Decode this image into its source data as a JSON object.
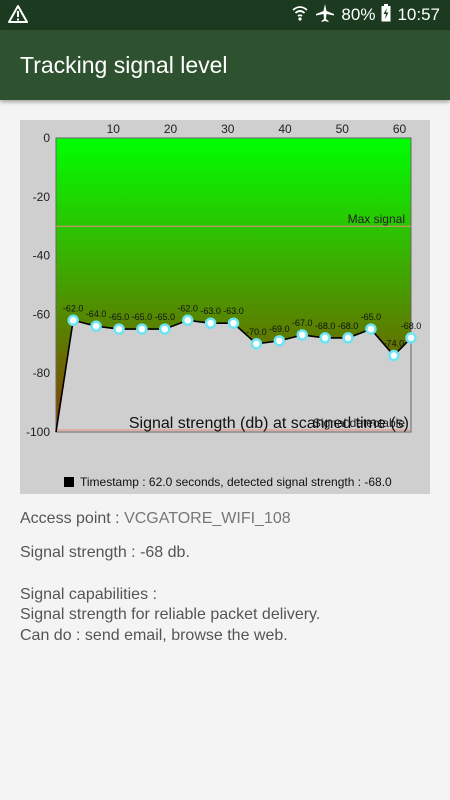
{
  "status_bar": {
    "warning_icon": "warning-icon",
    "battery": "80%",
    "time": "10:57",
    "icons": [
      "wifi-icon",
      "airplane-icon",
      "battery-charging-icon"
    ]
  },
  "app_bar": {
    "title": "Tracking signal level"
  },
  "chart_data": {
    "type": "line",
    "title": "Signal strength (db) at scanned time (s)",
    "xlim": [
      0,
      62
    ],
    "ylim": [
      -100,
      0
    ],
    "x_ticks": [
      "10",
      "20",
      "30",
      "40",
      "50",
      "60"
    ],
    "x_tick_values": [
      10,
      20,
      30,
      40,
      50,
      60
    ],
    "y_ticks": [
      "0",
      "-20",
      "-40",
      "-60",
      "-80",
      "-100"
    ],
    "y_tick_values": [
      0,
      -20,
      -40,
      -60,
      -80,
      -100
    ],
    "reference_lines": [
      {
        "label": "Max signal",
        "y": -30
      },
      {
        "label": "Signal detectable",
        "y": -100
      }
    ],
    "series": [
      {
        "x": [
          0,
          3,
          7,
          11,
          15,
          19,
          23,
          27,
          31,
          35,
          39,
          43,
          47,
          51,
          55,
          59,
          62
        ],
        "y": [
          -100,
          -62,
          -64,
          -65,
          -65,
          -65,
          -62,
          -63,
          -63,
          -70,
          -69,
          -67,
          -68,
          -68,
          -65,
          -74,
          -68
        ],
        "labels": [
          "",
          "-62.0",
          "-64.0",
          "-65.0",
          "-65.0",
          "-65.0",
          "-62.0",
          "-63.0",
          "-63.0",
          "-70.0",
          "-69.0",
          "-67.0",
          "-68.0",
          "-68.0",
          "-65.0",
          "-74.0",
          "-68.0"
        ]
      }
    ],
    "legend": {
      "text": "Timestamp : 62.0 seconds, detected signal strength : -68.0",
      "placement": "bottom"
    },
    "colors": {
      "background": "#cfcfcf",
      "gradient_top": "#00ff00",
      "gradient_bottom": "#8b3a00",
      "line": "#000000",
      "point_fill": "#ffffff",
      "point_stroke": "#6fe3f2",
      "reference_line": "#e88a7a"
    }
  },
  "info": {
    "access_point_label": "Access point :",
    "access_point_value": "VCGATORE_WIFI_108",
    "signal_strength": "Signal strength : -68 db.",
    "capabilities_title": "Signal capabilities :",
    "capabilities_line1": "Signal strength for reliable packet delivery.",
    "capabilities_line2": "Can do : send email, browse the web."
  }
}
